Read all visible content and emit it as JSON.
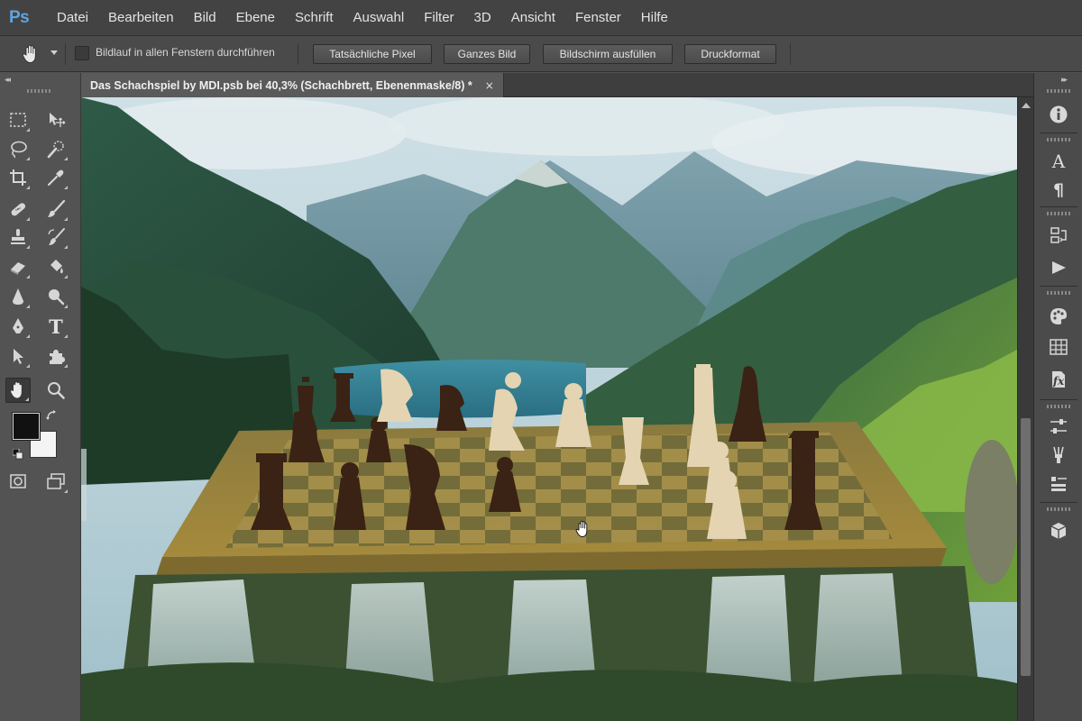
{
  "app": {
    "logo": "Ps",
    "menu": [
      "Datei",
      "Bearbeiten",
      "Bild",
      "Ebene",
      "Schrift",
      "Auswahl",
      "Filter",
      "3D",
      "Ansicht",
      "Fenster",
      "Hilfe"
    ]
  },
  "options": {
    "scroll_all_label": "Bildlauf in allen Fenstern durchführen",
    "scroll_all_checked": false,
    "buttons": [
      "Tatsächliche Pixel",
      "Ganzes Bild",
      "Bildschirm ausfüllen",
      "Druckformat"
    ]
  },
  "document": {
    "tab_title": "Das Schachspiel by MDI.psb bei 40,3% (Schachbrett, Ebenenmaske/8) *",
    "close_glyph": "×"
  },
  "tools": {
    "foreground_color": "#111111",
    "background_color": "#f4f4f4",
    "active": "hand-tool",
    "items": [
      "rectangular-marquee",
      "move",
      "lasso",
      "quick-selection",
      "crop",
      "eyedropper",
      "spot-healing-brush",
      "brush",
      "clone-stamp",
      "history-brush",
      "eraser",
      "paint-bucket",
      "blur",
      "dodge",
      "pen",
      "type",
      "path-selection",
      "custom-shape",
      "hand",
      "zoom"
    ],
    "type_glyph": "T"
  },
  "right_panel": {
    "icons": [
      "info-icon",
      "character-icon",
      "paragraph-icon",
      "history-icon",
      "actions-icon",
      "color-icon",
      "swatches-icon",
      "styles-icon",
      "adjustments-icon",
      "brush-presets-icon",
      "layer-comps-icon",
      "3d-icon"
    ],
    "character_glyph": "A",
    "paragraph_glyph": "¶",
    "styles_glyph": "fx"
  },
  "colors": {
    "menubar": "#434343",
    "panel": "#535353",
    "accent_logo": "#5fa4e0"
  }
}
